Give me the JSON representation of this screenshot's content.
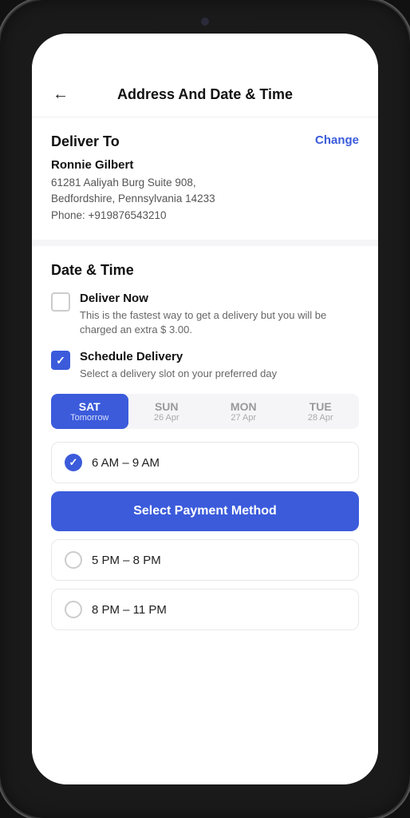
{
  "header": {
    "title": "Address And Date & Time",
    "back_label": "←"
  },
  "deliver_to": {
    "section_title": "Deliver To",
    "change_label": "Change",
    "name": "Ronnie Gilbert",
    "address_line1": "61281 Aaliyah Burg Suite 908,",
    "address_line2": "Bedfordshire, Pennsylvania 14233",
    "phone": "Phone: +919876543210"
  },
  "date_time": {
    "section_title": "Date & Time",
    "deliver_now": {
      "title": "Deliver Now",
      "description": "This is the fastest way to get a delivery but you will be charged an extra $ 3.00.",
      "checked": false
    },
    "schedule_delivery": {
      "title": "Schedule Delivery",
      "description": "Select a delivery slot on your preferred day",
      "checked": true
    }
  },
  "day_tabs": [
    {
      "day": "SAT",
      "sub": "Tomorrow",
      "active": true
    },
    {
      "day": "SUN",
      "sub": "26 Apr",
      "active": false
    },
    {
      "day": "MON",
      "sub": "27 Apr",
      "active": false
    },
    {
      "day": "TUE",
      "sub": "28 Apr",
      "active": false
    }
  ],
  "time_slots": [
    {
      "label": "6 AM – 9 AM",
      "selected": true
    },
    {
      "label": "5 PM – 8 PM",
      "selected": false
    },
    {
      "label": "8 PM – 11 PM",
      "selected": false
    }
  ],
  "payment_button": {
    "label": "Select Payment Method"
  },
  "colors": {
    "primary": "#3B5BDB",
    "text_dark": "#111",
    "text_muted": "#555",
    "bg_light": "#f5f5f7"
  }
}
